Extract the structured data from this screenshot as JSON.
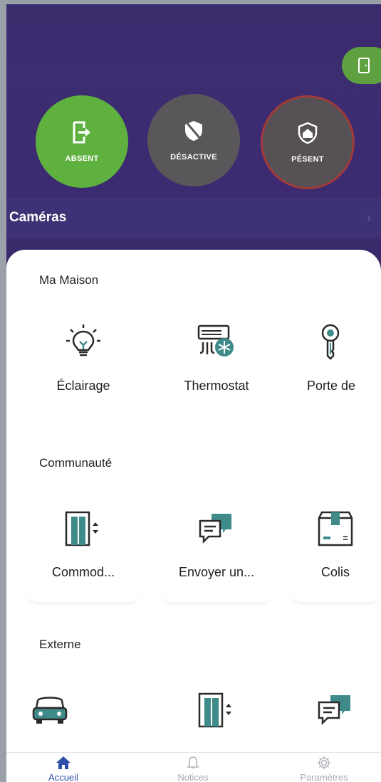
{
  "modes": {
    "absent": {
      "label": "ABSENT",
      "icon": "exit-door-icon",
      "color": "#5eb13f"
    },
    "desactive": {
      "label": "DÉSACTIVE",
      "icon": "shield-off-icon",
      "color": "#5a575a"
    },
    "present": {
      "label": "PÉSENT",
      "icon": "home-shield-icon",
      "color": "#555155",
      "border": "#a33a3a"
    }
  },
  "door_pill": {
    "icon": "door-icon",
    "color": "#5fa040"
  },
  "cameras": {
    "label": "Caméras",
    "icon": "chevron-right-icon"
  },
  "sections": {
    "ma_maison": {
      "title": "Ma Maison",
      "items": [
        {
          "label": "Éclairage",
          "icon": "lightbulb-icon"
        },
        {
          "label": "Thermostat",
          "icon": "air-conditioner-icon"
        },
        {
          "label": "Porte de",
          "icon": "key-icon"
        }
      ]
    },
    "communaute": {
      "title": "Communauté",
      "items": [
        {
          "label": "Commod...",
          "icon": "elevator-icon"
        },
        {
          "label": "Envoyer un...",
          "icon": "chat-bubbles-icon"
        },
        {
          "label": "Colis",
          "icon": "package-icon"
        }
      ]
    },
    "externe": {
      "title": "Externe",
      "items": [
        {
          "label": "",
          "icon": "car-icon"
        },
        {
          "label": "",
          "icon": "elevator-icon"
        },
        {
          "label": "",
          "icon": "chat-bubbles-icon"
        }
      ]
    }
  },
  "tabbar": {
    "home": {
      "label": "Accueil",
      "icon": "home-icon",
      "active": true
    },
    "notices": {
      "label": "Notices",
      "icon": "bell-icon"
    },
    "params": {
      "label": "Paramètres",
      "icon": "gear-icon"
    }
  },
  "colors": {
    "header_bg": "#3b2c6e",
    "accent_teal": "#3f8b8a",
    "active_tab": "#2f4fa8"
  }
}
